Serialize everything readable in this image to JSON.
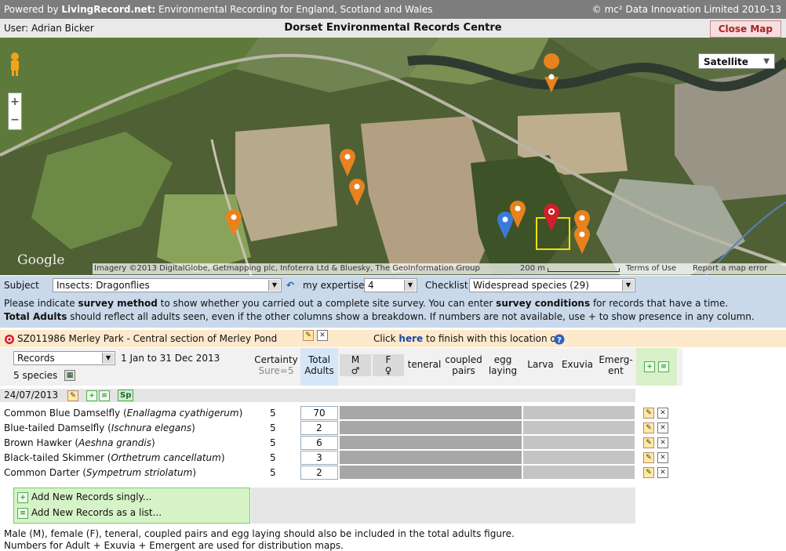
{
  "header": {
    "powered_prefix": "Powered by ",
    "powered_brand": "LivingRecord.net:",
    "powered_rest": " Environmental Recording for England, Scotland and Wales",
    "copyright": "© mc² Data Innovation Limited 2010-13"
  },
  "userbar": {
    "user": "User: Adrian Bicker",
    "title": "Dorset Environmental Records Centre",
    "close_map": "Close Map"
  },
  "map": {
    "type": "Satellite",
    "zoom_in": "+",
    "zoom_out": "−",
    "google": "Google",
    "imagery": "Imagery ©2013 DigitalGlobe, Getmapping plc, Infoterra Ltd & Bluesky, The GeoInformation Group",
    "scale": "200 m",
    "terms": "Terms of Use",
    "report": "Report a map error",
    "colors": {
      "orange_marker": "#e8821e",
      "blue_marker": "#3b7bd8",
      "red_marker": "#d11f2a",
      "selection_box": "#f0e000"
    }
  },
  "controls": {
    "subject_label": "Subject",
    "subject_value": "Insects: Dragonflies",
    "expertise_label": "my expertise",
    "expertise_value": "4",
    "checklist_label": "Checklist",
    "checklist_value": "Widespread species (29)"
  },
  "info": {
    "l1_a": "Please indicate ",
    "l1_b": "survey method",
    "l1_c": " to show whether you carried out a complete site survey. You can enter ",
    "l1_d": "survey conditions",
    "l1_e": " for records that have a time.",
    "l2_a": "Total Adults",
    "l2_b": " should reflect all adults seen, even if the other columns show a breakdown. If numbers are not available, use + to show presence in any column."
  },
  "location": {
    "name": "SZ011986 Merley Park - Central section of Merley Pond",
    "click_pre": "Click ",
    "click_link": "here",
    "click_post": " to finish with this location or"
  },
  "grid": {
    "records_label": "Records",
    "date_range": "1 Jan to 31 Dec 2013",
    "species_count": "5 species",
    "columns": {
      "certainty": "Certainty",
      "certainty_sub": "Sure=5",
      "total": "Total",
      "total_sub": "Adults",
      "m": "M",
      "m_sub": "♂",
      "f": "F",
      "f_sub": "♀",
      "teneral": "teneral",
      "coupled": "coupled",
      "coupled_sub": "pairs",
      "egg": "egg",
      "egg_sub": "laying",
      "larva": "Larva",
      "exuvia": "Exuvia",
      "emerg": "Emerg-",
      "emerg_sub": "ent"
    },
    "date_row": "24/07/2013",
    "sp_btn": "Sp",
    "rows": [
      {
        "common": "Common Blue Damselfly (",
        "latin": "Enallagma cyathigerum",
        "close": ")",
        "certainty": "5",
        "total": "70"
      },
      {
        "common": "Blue-tailed Damselfly (",
        "latin": "Ischnura elegans",
        "close": ")",
        "certainty": "5",
        "total": "2"
      },
      {
        "common": "Brown Hawker (",
        "latin": "Aeshna grandis",
        "close": ")",
        "certainty": "5",
        "total": "6"
      },
      {
        "common": "Black-tailed Skimmer (",
        "latin": "Orthetrum cancellatum",
        "close": ")",
        "certainty": "5",
        "total": "3"
      },
      {
        "common": "Common Darter (",
        "latin": "Sympetrum striolatum",
        "close": ")",
        "certainty": "5",
        "total": "2"
      }
    ],
    "add_singly": "Add New Records singly...",
    "add_list": "Add New Records as a list..."
  },
  "footer": {
    "line1": "Male (M), female (F), teneral, coupled pairs and egg laying should also be included in the total adults figure.",
    "line2": "Numbers for Adult + Exuvia + Emergent are used for distribution maps."
  }
}
